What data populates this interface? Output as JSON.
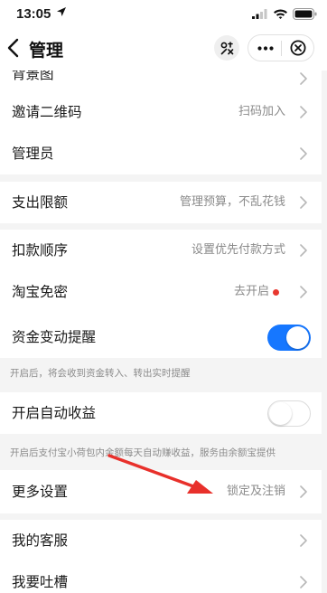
{
  "status_bar": {
    "time": "13:05"
  },
  "nav": {
    "title": "管理"
  },
  "rows": {
    "background": {
      "label": "背景图"
    },
    "invite_qr": {
      "label": "邀请二维码",
      "value": "扫码加入"
    },
    "admins": {
      "label": "管理员"
    },
    "spending_limit": {
      "label": "支出限额",
      "value": "管理预算，不乱花钱"
    },
    "payment_order": {
      "label": "扣款顺序",
      "value": "设置优先付款方式"
    },
    "taobao_nopwd": {
      "label": "淘宝免密",
      "value": "去开启"
    },
    "fund_alert": {
      "label": "资金变动提醒",
      "enabled": true,
      "hint": "开启后，将会收到资金转入、转出实时提醒"
    },
    "auto_earn": {
      "label": "开启自动收益",
      "enabled": false,
      "hint": "开启后支付宝小荷包内余额每天自动赚收益，服务由余额宝提供"
    },
    "more_settings": {
      "label": "更多设置",
      "value": "锁定及注销"
    },
    "customer_service": {
      "label": "我的客服"
    },
    "feedback": {
      "label": "我要吐槽"
    }
  },
  "colors": {
    "accent": "#1677ff",
    "badge_dot": "#e8382f",
    "annotation_arrow": "#e8302b"
  },
  "icons": [
    "location-arrow-icon",
    "signal-icon",
    "wifi-icon",
    "battery-icon",
    "back-chevron-icon",
    "scan-icon",
    "more-dots-icon",
    "close-circle-icon",
    "chevron-right-icon"
  ]
}
